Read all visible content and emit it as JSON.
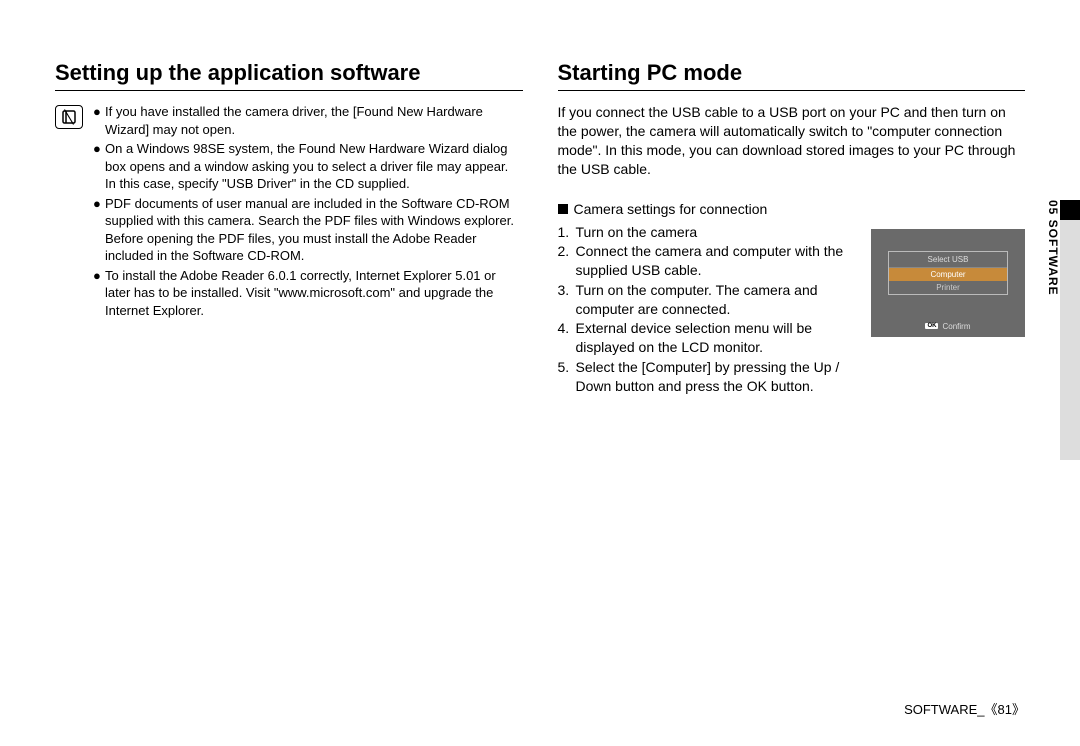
{
  "left": {
    "heading": "Setting up the application software",
    "bullets": [
      "If you have installed the camera driver, the [Found New Hardware Wizard] may not open.",
      "On a Windows 98SE system, the Found New Hardware Wizard dialog box opens and a window asking you to select a driver file may appear. In this case, specify \"USB Driver\" in the CD supplied.",
      "PDF documents of user manual are included in the Software CD-ROM supplied with this camera. Search the PDF files with Windows explorer.\nBefore opening the PDF files, you must install the Adobe Reader included in the Software CD-ROM.",
      "To install the Adobe Reader 6.0.1 correctly, Internet Explorer 5.01 or later has to be installed. Visit \"www.microsoft.com\" and upgrade the Internet Explorer."
    ]
  },
  "right": {
    "heading": "Starting PC mode",
    "intro": "If you connect the USB cable to a USB port on your PC and then turn on the power, the camera will automatically switch to \"computer connection mode\". In this mode, you can download stored images to your PC through the USB cable.",
    "section_label": "Camera settings for connection",
    "steps": [
      "Turn on the camera",
      "Connect the camera and computer with the supplied USB cable.",
      "Turn on the computer. The camera and computer are connected.",
      "External device selection menu will be displayed on the LCD monitor.",
      "Select the [Computer] by pressing the Up / Down button and press the OK button."
    ],
    "lcd": {
      "title": "Select USB",
      "opt_selected": "Computer",
      "opt_other": "Printer",
      "ok": "OK",
      "confirm": "Confirm"
    }
  },
  "side_tab": "05 SOFTWARE",
  "footer": {
    "section": "SOFTWARE_",
    "page": "81"
  }
}
